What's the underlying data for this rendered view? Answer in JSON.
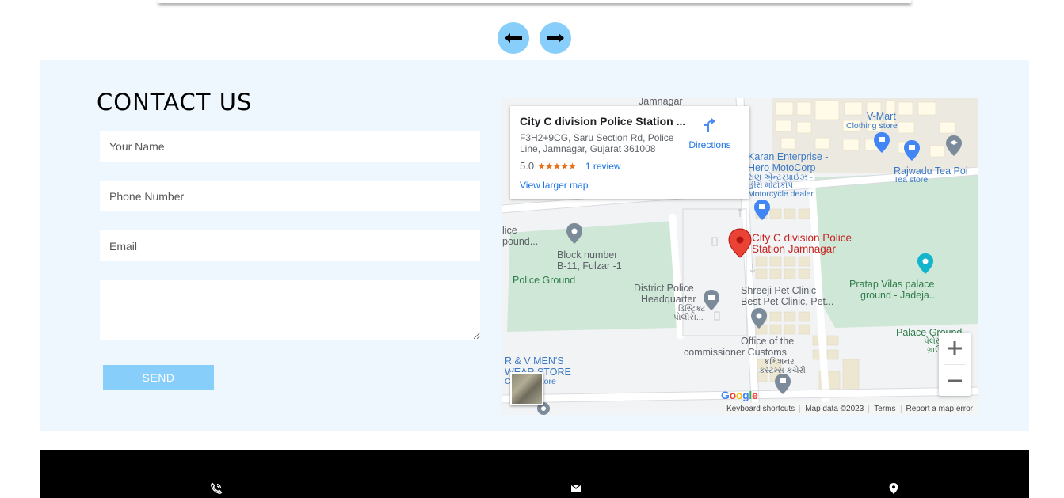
{
  "nav": {
    "prev_icon": "arrow-left-icon",
    "next_icon": "arrow-right-icon",
    "button_color": "#87cefa"
  },
  "contact": {
    "title": "CONTACT US",
    "name_placeholder": "Your Name",
    "phone_placeholder": "Phone Number",
    "email_placeholder": "Email",
    "message_placeholder": "",
    "send_label": "SEND",
    "background": "#eef7fe"
  },
  "map": {
    "card": {
      "title": "City C division Police Station ...",
      "address": "F3H2+9CG, Saru Section Rd, Police Line, Jamnagar, Gujarat 361008",
      "rating": "5.0",
      "stars": "★★★★★",
      "reviews": "1 review",
      "directions": "Directions",
      "view_larger": "View larger map"
    },
    "labels": {
      "jamnagar": "Jamnagar",
      "v_mart": "V-Mart",
      "clothing": "Clothing store",
      "karan_1": "Karan Enterprise -",
      "karan_2": "Hero MotoCorp",
      "karan_guj_1": "રાણ એન્ટરપ્રાઈઝ -",
      "karan_guj_2": "હીરો મોટોકોર્પ",
      "moto": "Motorcycle dealer",
      "rajwadu": "Rajwadu Tea Poi",
      "tea_store": "Tea store",
      "lice_1": "lice",
      "lice_2": "pound...",
      "block_1": "Block number",
      "block_2": "B-11, Fulzar -1",
      "police_ground": "Police Ground",
      "station_1": "City C division Police",
      "station_2": "Station Jamnagar",
      "pratap_1": "Pratap Vilas palace",
      "pratap_2": "ground - Jadeja...",
      "district_1": "District Police",
      "district_2": "Headquarter",
      "district_guj_1": "ડિસ્ટ્રિક્ટ",
      "district_guj_2": "પોલીસ...",
      "shreeji_1": "Shreeji Pet Clinic -",
      "shreeji_2": "Best Pet Clinic, Pet...",
      "palace_ground": "Palace Ground",
      "palace_guj_1": "પેલેસ",
      "palace_guj_2": "ગ્રાઉ",
      "office_1": "Office of the",
      "office_2": "commissioner Customs",
      "office_guj_1": "કમિશનર",
      "office_guj_2": "કસ્ટમ્સ કચેરી",
      "rv_1": "R & V MEN'S",
      "rv_2": "WEAR STORE",
      "rv_3": "Clothing store"
    },
    "google_logo": "Google",
    "footer": {
      "shortcuts": "Keyboard shortcuts",
      "map_data": "Map data ©2023",
      "terms": "Terms",
      "report": "Report a map error"
    },
    "zoom_in_icon": "plus-icon",
    "zoom_out_icon": "minus-icon"
  },
  "footer": {
    "icons": [
      "phone-icon",
      "mail-icon",
      "location-pin-icon"
    ],
    "background": "#000000"
  }
}
